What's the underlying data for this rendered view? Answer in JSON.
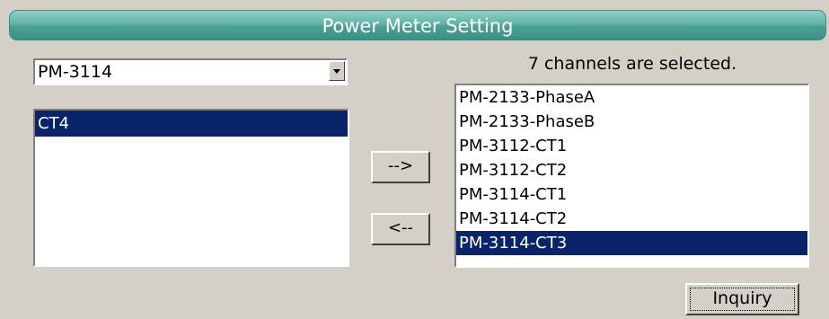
{
  "title": "Power Meter Setting",
  "meter_select": {
    "selected_value": "PM-3114"
  },
  "available_channels": [
    {
      "label": "CT4",
      "selected": true
    }
  ],
  "add_button_label": "-->",
  "remove_button_label": "<--",
  "status_text": "7 channels are selected.",
  "selected_channels": [
    {
      "label": "PM-2133-PhaseA",
      "selected": false
    },
    {
      "label": "PM-2133-PhaseB",
      "selected": false
    },
    {
      "label": "PM-3112-CT1",
      "selected": false
    },
    {
      "label": "PM-3112-CT2",
      "selected": false
    },
    {
      "label": "PM-3114-CT1",
      "selected": false
    },
    {
      "label": "PM-3114-CT2",
      "selected": false
    },
    {
      "label": "PM-3114-CT3",
      "selected": true
    }
  ],
  "inquiry_button_label": "Inquiry",
  "colors": {
    "title_bar": "#64b3a8",
    "selection": "#0a246a",
    "background": "#d4d0c8"
  }
}
